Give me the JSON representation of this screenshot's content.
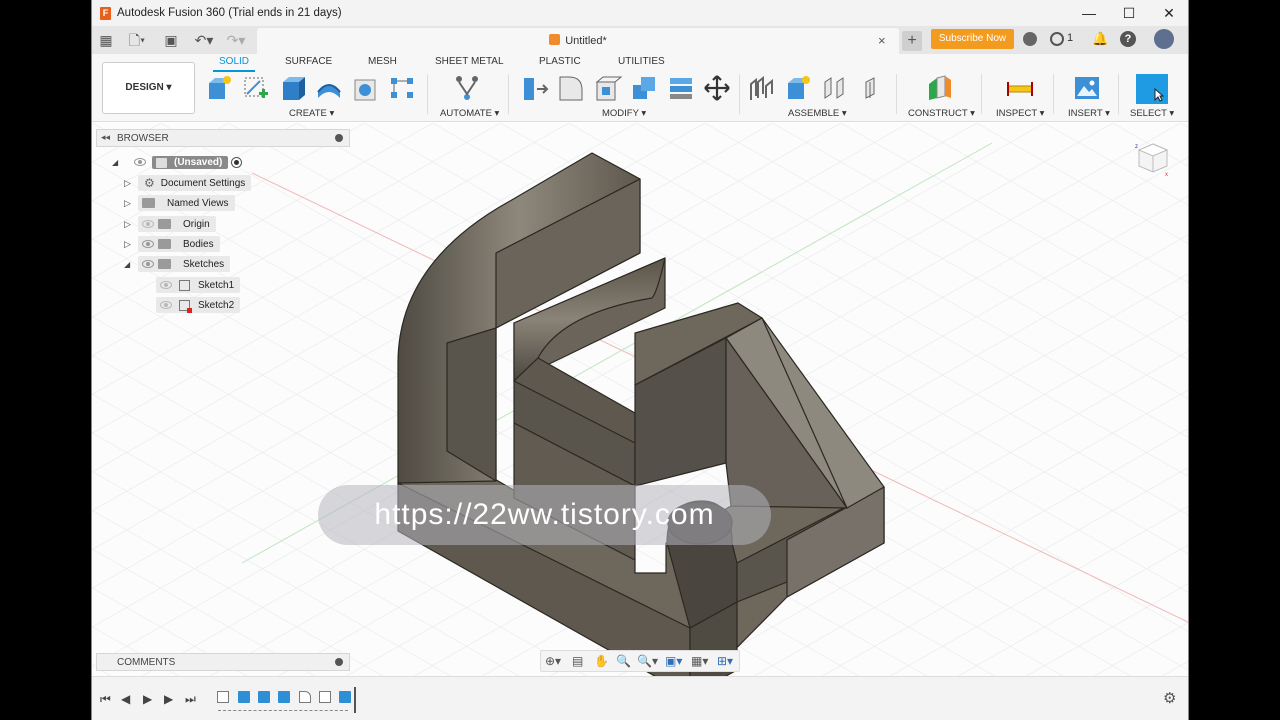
{
  "window": {
    "title": "Autodesk Fusion 360 (Trial ends in 21 days)",
    "logo": "F",
    "minimize": "—",
    "maximize": "☐",
    "close": "✕"
  },
  "appbar": {
    "doc_tab_title": "Untitled*",
    "tab_close": "×",
    "new_tab": "+",
    "subscribe": "Subscribe Now",
    "jobs_count": "1",
    "help": "?"
  },
  "ribbon": {
    "workspace": "DESIGN ▾",
    "tabs": [
      "SOLID",
      "SURFACE",
      "MESH",
      "SHEET METAL",
      "PLASTIC",
      "UTILITIES"
    ],
    "groups": [
      "CREATE ▾",
      "AUTOMATE ▾",
      "MODIFY ▾",
      "ASSEMBLE ▾",
      "CONSTRUCT ▾",
      "INSPECT ▾",
      "INSERT ▾",
      "SELECT ▾"
    ]
  },
  "browser": {
    "title": "BROWSER",
    "root": "(Unsaved)",
    "items": [
      "Document Settings",
      "Named Views",
      "Origin",
      "Bodies",
      "Sketches"
    ],
    "sketches": [
      "Sketch1",
      "Sketch2"
    ]
  },
  "comments": {
    "title": "COMMENTS"
  },
  "watermark": "https://22ww.tistory.com",
  "colors": {
    "accent": "#0696d7",
    "subscribe": "#f39b1f",
    "model": "#6b6558"
  }
}
